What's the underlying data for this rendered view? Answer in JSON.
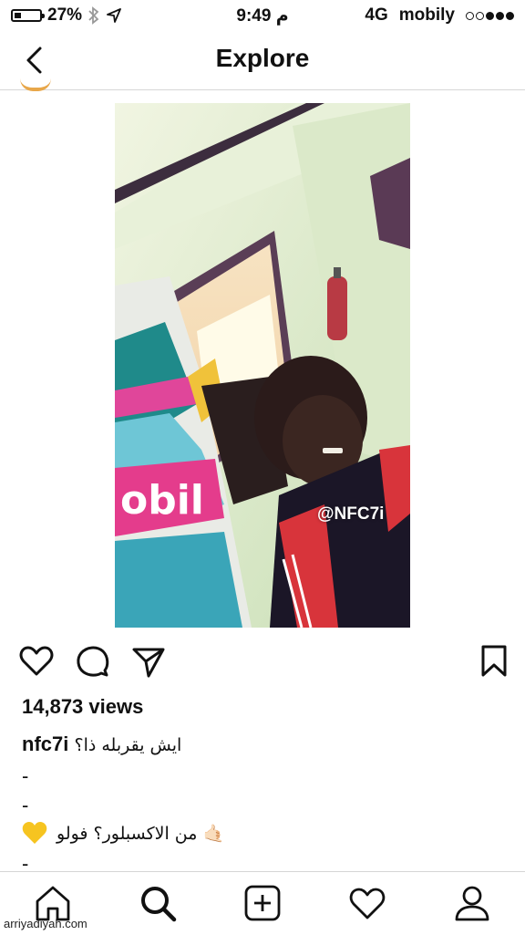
{
  "status": {
    "battery_percent": "27%",
    "battery_level": 0.27,
    "time": "9:49 م",
    "network": "4G",
    "carrier": "mobily",
    "signal_bars": 3,
    "signal_max": 5
  },
  "nav": {
    "title": "Explore",
    "back_icon": "chevron-left-icon"
  },
  "post": {
    "watermark": "@NFC7i",
    "views": "14,873 views",
    "username": "nfc7i",
    "caption": "ايش يقربله ذا؟",
    "dash1": "-",
    "dash2": "-",
    "caption2": "من الاكسبلور؟ فولو 🤙🏻",
    "dash3": "-",
    "action_icons": [
      "heart-icon",
      "comment-icon",
      "share-icon",
      "bookmark-icon"
    ]
  },
  "tabs": [
    "home-icon",
    "search-icon",
    "add-post-icon",
    "activity-heart-icon",
    "profile-icon"
  ],
  "footer": {
    "site": "arriyadiyah.com"
  },
  "colors": {
    "accent_yellow": "#f6c420",
    "avatar_ring": "#e8a74a"
  }
}
